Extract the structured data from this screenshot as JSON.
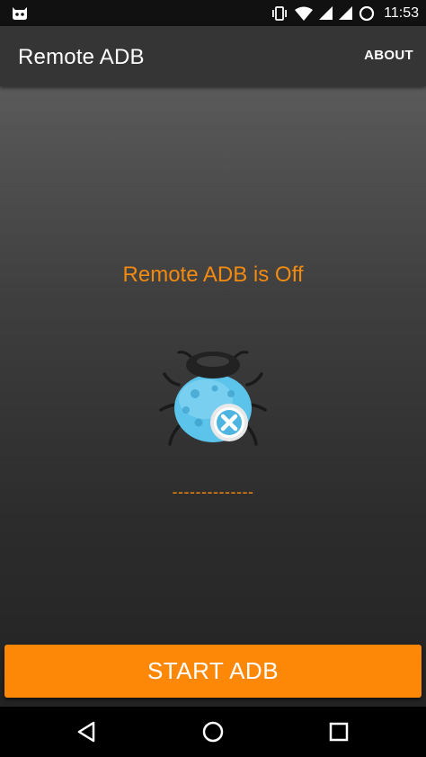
{
  "status_bar": {
    "time": "11:53",
    "icons": [
      "cyanogen-icon",
      "vibrate-icon",
      "wifi-icon",
      "signal-icon",
      "signal-icon-2",
      "data-saver-icon"
    ]
  },
  "app_bar": {
    "title": "Remote ADB",
    "about_label": "ABOUT"
  },
  "main": {
    "status_text": "Remote ADB is Off",
    "status_icon": "bug-disabled-icon",
    "ip_address": "--------------"
  },
  "start_button_label": "START ADB",
  "nav_bar": {
    "icons": [
      "back-icon",
      "home-icon",
      "recents-icon"
    ]
  },
  "colors": {
    "accent": "#fd8808",
    "status_text": "#f28a10",
    "app_bar": "#353535"
  }
}
